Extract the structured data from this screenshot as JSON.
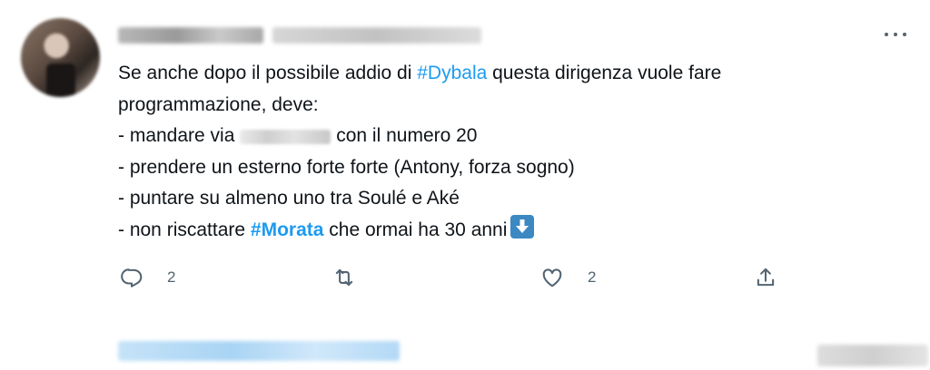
{
  "tweet": {
    "text": {
      "l1_pre": "Se anche dopo il possibile addio di ",
      "l1_hashtag": "#Dybala",
      "l1_post": " questa dirigenza vuole fare",
      "l2": "programmazione, deve:",
      "l3_pre": "- mandare via ",
      "l3_post": "con il numero 20",
      "l4": "- prendere un esterno forte forte (Antony, forza sogno)",
      "l5": "- puntare su almeno uno tra Soulé e Aké",
      "l6_pre": "- non riscattare ",
      "l6_hashtag": "#Morata",
      "l6_post": " che ormai ha 30 anni"
    },
    "emoji": "down-arrow-emoji",
    "actions": {
      "reply_count": "2",
      "retweet_count": "",
      "like_count": "2"
    }
  },
  "colors": {
    "hashtag": "#1d9bf0",
    "text": "#0f1419",
    "icon": "#536471",
    "emoji_bg": "#3b88c3"
  },
  "icons": [
    "more-icon",
    "reply-icon",
    "retweet-icon",
    "like-icon",
    "share-icon"
  ]
}
